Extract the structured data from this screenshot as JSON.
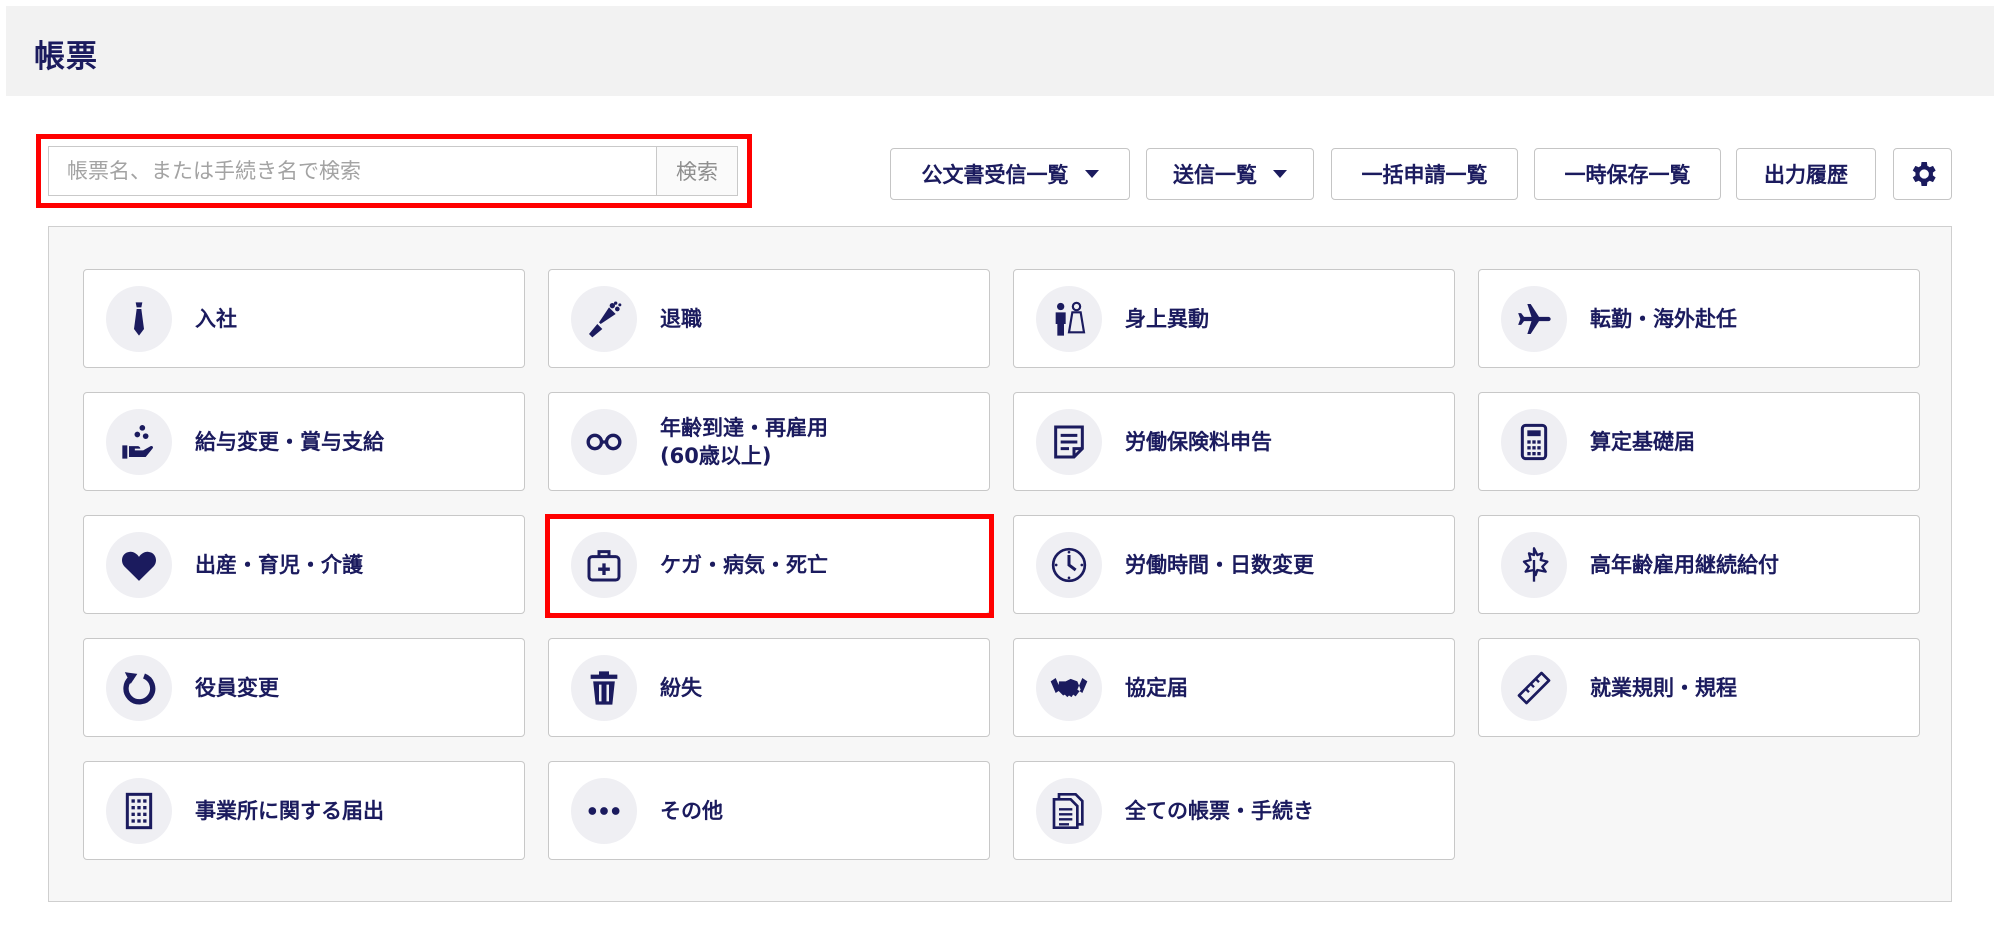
{
  "header": {
    "title": "帳票"
  },
  "search": {
    "placeholder": "帳票名、または手続き名で検索",
    "button_label": "検索"
  },
  "toolbar": {
    "official_docs_label": "公文書受信一覧",
    "sent_list_label": "送信一覧",
    "batch_list_label": "一括申請一覧",
    "temp_save_label": "一時保存一覧",
    "output_history_label": "出力履歴"
  },
  "categories": [
    {
      "label": "入社",
      "icon": "necktie-icon"
    },
    {
      "label": "退職",
      "icon": "bouquet-icon"
    },
    {
      "label": "身上異動",
      "icon": "couple-icon"
    },
    {
      "label": "転勤・海外赴任",
      "icon": "airplane-icon"
    },
    {
      "label": "給与変更・賞与支給",
      "icon": "coins-hand-icon"
    },
    {
      "label": "年齢到達・再雇用\n(60歳以上)",
      "icon": "glasses-icon"
    },
    {
      "label": "労働保険料申告",
      "icon": "document-icon"
    },
    {
      "label": "算定基礎届",
      "icon": "calculator-icon"
    },
    {
      "label": "出産・育児・介護",
      "icon": "heart-icon"
    },
    {
      "label": "ケガ・病気・死亡",
      "icon": "first-aid-kit-icon"
    },
    {
      "label": "労働時間・日数変更",
      "icon": "clock-icon"
    },
    {
      "label": "高年齢雇用継続給付",
      "icon": "maple-leaf-icon"
    },
    {
      "label": "役員変更",
      "icon": "refresh-icon"
    },
    {
      "label": "紛失",
      "icon": "trash-icon"
    },
    {
      "label": "協定届",
      "icon": "handshake-icon"
    },
    {
      "label": "就業規則・規程",
      "icon": "ruler-icon"
    },
    {
      "label": "事業所に関する届出",
      "icon": "building-icon"
    },
    {
      "label": "その他",
      "icon": "more-dots-icon"
    },
    {
      "label": "全ての帳票・手続き",
      "icon": "documents-icon"
    }
  ],
  "colors": {
    "accent": "#1b1b5e",
    "highlight": "#ff0000"
  }
}
